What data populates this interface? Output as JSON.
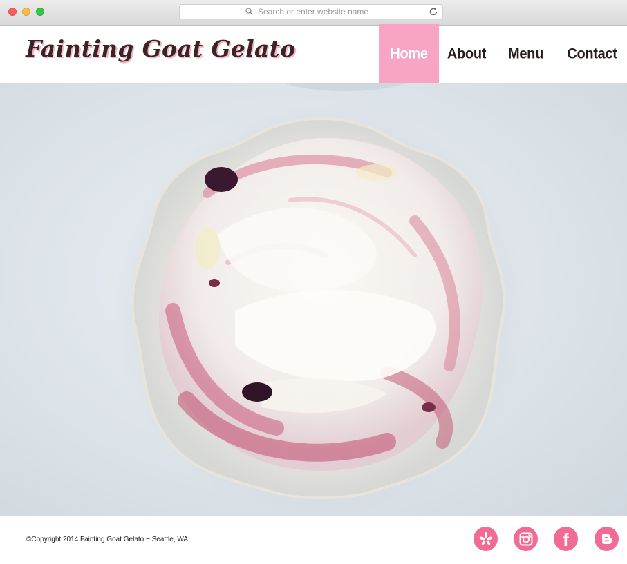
{
  "browser": {
    "url_placeholder": "Search or enter website name"
  },
  "site": {
    "logo": "Fainting Goat Gelato",
    "nav": [
      {
        "label": "Home",
        "active": true
      },
      {
        "label": "About",
        "active": false
      },
      {
        "label": "Menu",
        "active": false
      },
      {
        "label": "Contact",
        "active": false
      }
    ]
  },
  "footer": {
    "copyright": "©Copyright 2014 Fainting Goat Gelato ~ Seattle, WA",
    "social": [
      "yelp-icon",
      "instagram-icon",
      "facebook-icon",
      "blogger-icon"
    ]
  },
  "colors": {
    "accent_pink": "#f8a4c4",
    "icon_pink": "#f26b94",
    "logo_brown": "#3a2424"
  }
}
